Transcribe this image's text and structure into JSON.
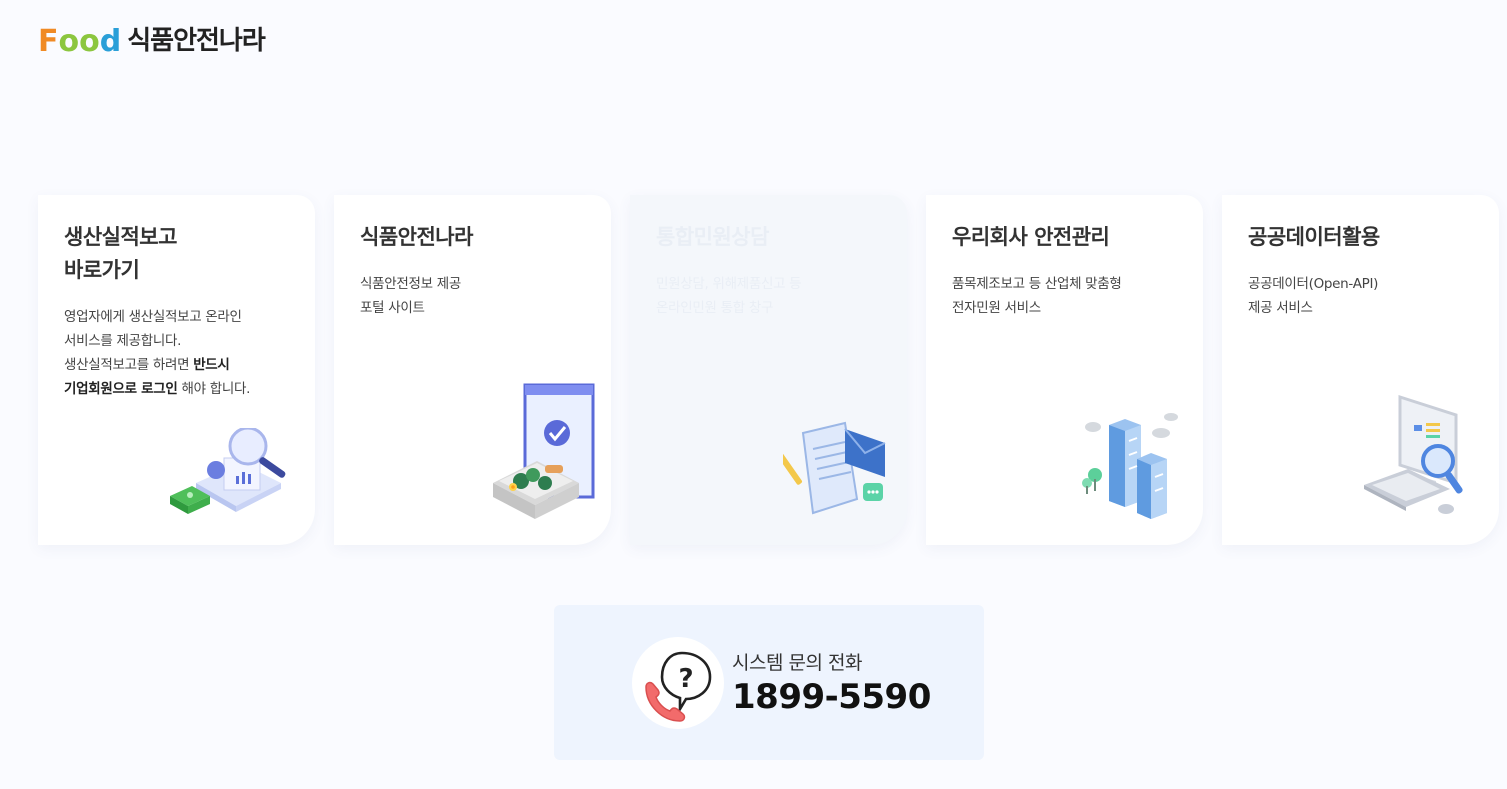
{
  "logo": {
    "food_letters": [
      "F",
      "o",
      "o",
      "d"
    ],
    "text": "식품안전나라"
  },
  "cards": [
    {
      "title": "생산실적보고\n바로가기",
      "desc_lines": [
        {
          "text": "영업자에게 생산실적보고 온라인"
        },
        {
          "text": "서비스를 제공합니다."
        },
        {
          "text": "생산실적보고를 하려면 ",
          "bold": "반드시"
        },
        {
          "bold": "기업회원으로 로그인",
          "text": " 해야 합니다."
        }
      ],
      "icon": "report-magnifier-icon"
    },
    {
      "title": "식품안전나라",
      "desc_lines": [
        {
          "text": "식품안전정보 제공"
        },
        {
          "text": "포털 사이트"
        }
      ],
      "icon": "food-tray-check-icon"
    },
    {
      "title": "통합민원상담",
      "desc_lines": [
        {
          "text": "민원상담, 위해제품신고 등"
        },
        {
          "text": "온라인민원 통합 창구"
        }
      ],
      "icon": "document-mail-icon"
    },
    {
      "title": "우리회사 안전관리",
      "desc_lines": [
        {
          "text": "품목제조보고 등 산업체 맞춤형"
        },
        {
          "text": "전자민원 서비스"
        }
      ],
      "icon": "office-building-icon"
    },
    {
      "title": "공공데이터활용",
      "desc_lines": [
        {
          "text": "공공데이터(Open-API)"
        },
        {
          "text": "제공 서비스"
        }
      ],
      "icon": "computer-search-icon"
    }
  ],
  "contact": {
    "label": "시스템 문의 전화",
    "phone": "1899-5590",
    "icon": "phone-question-icon"
  },
  "colors": {
    "food_f": "#f08a24",
    "food_o": "#8cc63f",
    "food_d": "#2a9fd8",
    "background": "#fafbff",
    "contact_bg": "#eef4fe"
  }
}
